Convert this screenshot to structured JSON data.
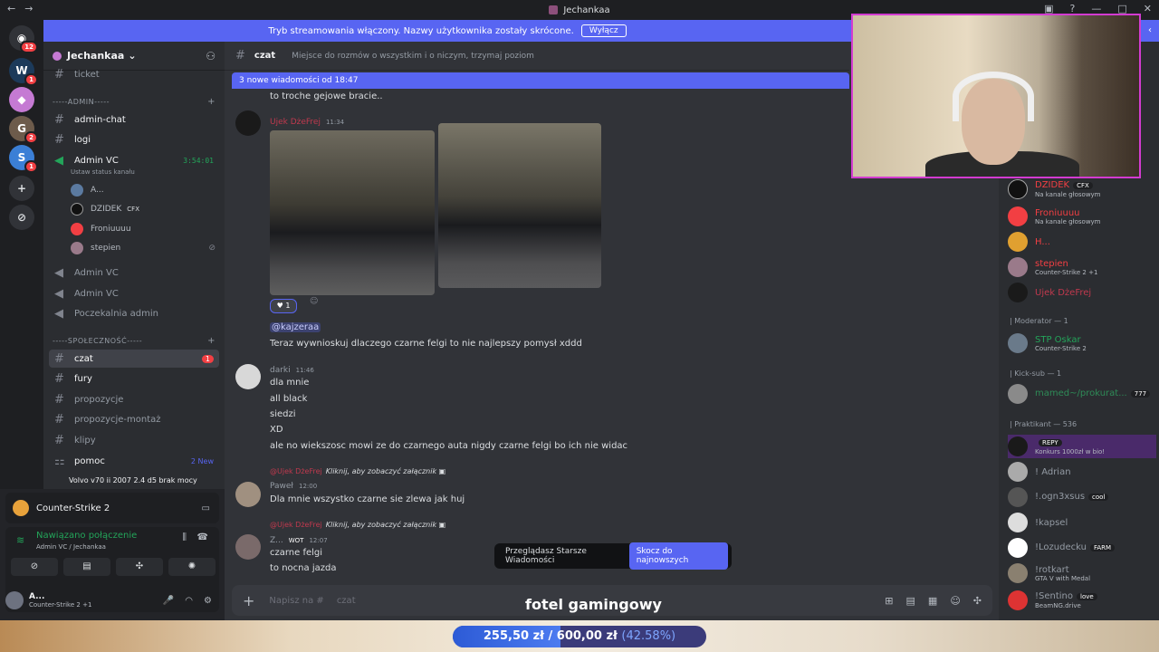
{
  "window": {
    "title": "Jechankaa"
  },
  "banner": {
    "text": "Tryb streamowania włączony. Nazwy użytkownika zostały skrócone.",
    "button": "Wyłącz"
  },
  "servers": [
    {
      "badge": "12"
    },
    {
      "badge": "1"
    },
    {
      "badge": ""
    },
    {
      "badge": "2"
    },
    {
      "badge": "1"
    }
  ],
  "guild": {
    "name": "Jechankaa"
  },
  "channels": {
    "ticket": "ticket",
    "admin_cat": "-----ADMIN-----",
    "admin_chat": "admin-chat",
    "logi": "logi",
    "admin_vc": "Admin VC",
    "admin_vc_timer": "3:54:01",
    "status_hint": "Ustaw status kanału",
    "voice_users": [
      {
        "name": "A...",
        "tag": ""
      },
      {
        "name": "DZIDEK",
        "tag": "CFX"
      },
      {
        "name": "Froniuuuu",
        "tag": ""
      },
      {
        "name": "stepien",
        "tag": ""
      }
    ],
    "admin_vc_2": "Admin VC",
    "admin_vc_3": "Admin VC",
    "poczekalnia": "Poczekalnia admin",
    "spol_cat": "-----SPOŁECZNOŚĆ-----",
    "czat": "czat",
    "czat_count": "1",
    "fury": "fury",
    "propozycje": "propozycje",
    "propozycje_montaz": "propozycje-montaż",
    "klipy": "klipy",
    "pomoc": "pomoc",
    "pomoc_new": "2 New",
    "thread": "Volvo v70 ii 2007 2.4 d5 brak mocy"
  },
  "user_panel": {
    "game": "Counter-Strike 2",
    "connection": "Nawiązano połączenie",
    "connection_sub": "Admin VC / Jechankaa",
    "user_name": "A...",
    "user_status": "Counter-Strike 2 +1"
  },
  "header": {
    "channel": "czat",
    "topic": "Miejsce do rozmów o wszystkim i o niczym, trzymaj poziom"
  },
  "new_messages": "3 nowe wiadomości od 18:47",
  "messages": {
    "m0_text": "to troche gejowe bracie..",
    "m1_name": "Ujek DżeFrej",
    "m1_time": "11:34",
    "reaction_count": "1",
    "mention": "@kajzeraa",
    "m1_text": "Teraz wywnioskuj dlaczego czarne felgi to nie najlepszy pomysł xddd",
    "m2_name": "darki",
    "m2_time": "11:46",
    "m2_lines": [
      "dla mnie",
      "all black",
      "siedzi",
      "XD",
      "ale no wiekszosc mowi ze do czarnego auta nigdy czarne felgi bo ich nie widac"
    ],
    "reply1_name": "@Ujek DżeFrej",
    "reply_label": "Kliknij, aby zobaczyć załącznik",
    "m3_name": "Paweł",
    "m3_time": "12:00",
    "m3_text": "Dla mnie wszystko czarne sie zlewa jak huj",
    "reply2_name": "@Ujek DżeFrej",
    "m4_name": "Z...",
    "m4_tag": "WOT",
    "m4_time": "12:07",
    "m4_lines": [
      "czarne felgi",
      "to nocna jazda"
    ]
  },
  "jump": {
    "label": "Przeglądasz Starsze Wiadomości",
    "button": "Skocz do najnowszych"
  },
  "composer": {
    "placeholder": "Napisz na #",
    "channel": "czat"
  },
  "overlay_text": "fotel gamingowy",
  "members": {
    "list": [
      {
        "name": "DZIDEK",
        "tag": "CFX",
        "sub": "Na kanale głosowym",
        "color": "#f23f43"
      },
      {
        "name": "Froniuuuu",
        "tag": "",
        "sub": "Na kanale głosowym",
        "color": "#f23f43"
      },
      {
        "name": "H...",
        "tag": "",
        "sub": "",
        "color": "#f23f43"
      },
      {
        "name": "stepien",
        "tag": "",
        "sub": "Counter-Strike 2 +1",
        "color": "#f23f43"
      },
      {
        "name": "Ujek DżeFrej",
        "tag": "",
        "sub": "",
        "color": "#c0394e"
      }
    ],
    "mod_cat": "| Moderator — 1",
    "mod": {
      "name": "STP Oskar",
      "sub": "Counter-Strike 2"
    },
    "kick_cat": "| Kick-sub — 1",
    "kick": {
      "name": "mamed~/prokurat...",
      "tag": "777"
    },
    "prak_cat": "| Praktikant — 536",
    "prak": [
      {
        "name": "",
        "tag": "REPY",
        "sub": "Konkurs 1000zł w bio!"
      },
      {
        "name": "! Adrian",
        "tag": "",
        "sub": ""
      },
      {
        "name": "!.ogn3xsus",
        "tag": "cool",
        "sub": ""
      },
      {
        "name": "!kapsel",
        "tag": "",
        "sub": ""
      },
      {
        "name": "!Lozudecku",
        "tag": "FARM",
        "sub": ""
      },
      {
        "name": "!rotkart",
        "tag": "",
        "sub": "GTA V with Medal"
      },
      {
        "name": "!Sentino",
        "tag": "love",
        "sub": "BeamNG.drive"
      }
    ]
  },
  "goal": {
    "current": "255,50 zł",
    "target": "600,00 zł",
    "percent_label": "(42.58%)",
    "percent": 42.58
  }
}
